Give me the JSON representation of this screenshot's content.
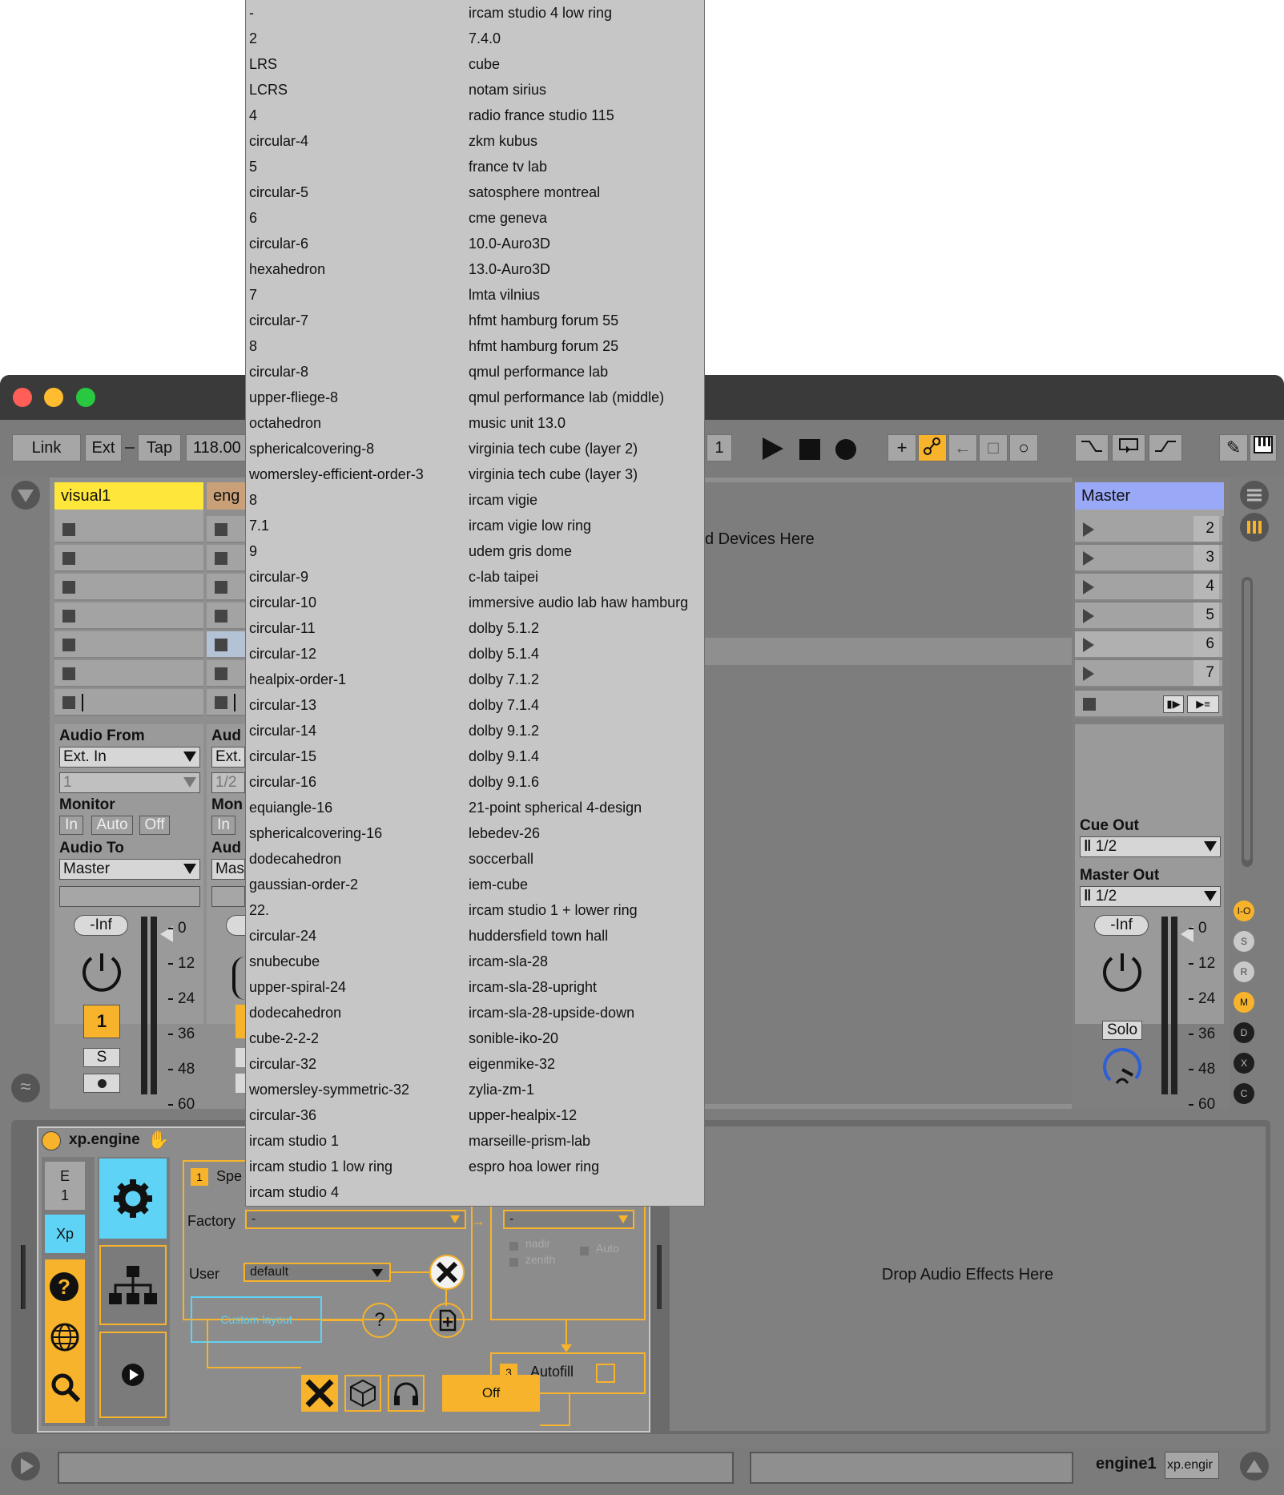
{
  "window": {
    "title_controls": [
      "close",
      "minimize",
      "zoom"
    ]
  },
  "transport": {
    "link": "Link",
    "ext": "Ext",
    "tap": "Tap",
    "tempo": "118.00",
    "bar": "1"
  },
  "tracks": {
    "visual1": {
      "name": "visual1",
      "audio_from_label": "Audio From",
      "audio_from_value": "Ext. In",
      "channel_value": "1",
      "monitor_label": "Monitor",
      "monitor_options": [
        "In",
        "Auto",
        "Off"
      ],
      "audio_to_label": "Audio To",
      "audio_to_value": "Master",
      "volume": "-Inf",
      "track_number": "1",
      "solo": "S"
    },
    "engine1_partial": {
      "name": "eng",
      "audio_from_label": "Aud",
      "audio_from_value": "Ext.",
      "channel_value": "1/2",
      "monitor_label": "Mon",
      "monitor_in": "In",
      "audio_to_label": "Aud",
      "audio_to_value": "Mas"
    },
    "master": {
      "name": "Master",
      "scenes": [
        "2",
        "3",
        "4",
        "5",
        "6",
        "7"
      ],
      "cue_out_label": "Cue Out",
      "cue_out_value": "1/2",
      "master_out_label": "Master Out",
      "master_out_value": "1/2",
      "volume": "-Inf",
      "solo": "Solo"
    }
  },
  "meter_ticks": [
    "0",
    "12",
    "24",
    "36",
    "48",
    "60"
  ],
  "drop_devices_text": "d Devices Here",
  "device": {
    "name": "xp.engine",
    "tab_e": "E",
    "tab_e_num": "1",
    "tab_xp": "Xp",
    "section1_num": "1",
    "section1_label": "Spe",
    "factory_label": "Factory",
    "factory_value": "-",
    "second_value": "-",
    "user_label": "User",
    "user_value": "default",
    "nadir": "nadir",
    "zenith": "zenith",
    "auto": "Auto",
    "custom_layout": "Custom layout",
    "help_q": "?",
    "autofill_num": "3",
    "autofill_label": "Autofill",
    "off_button": "Off",
    "drop_effects": "Drop Audio Effects Here"
  },
  "status": {
    "track_name": "engine1",
    "device_name": "xp.engir"
  },
  "side_letters": [
    "I-O",
    "S",
    "R",
    "M",
    "D",
    "X",
    "C"
  ],
  "menu": {
    "col1": [
      "-",
      "2",
      "LRS",
      "LCRS",
      "4",
      "circular-4",
      "5",
      "circular-5",
      "6",
      "circular-6",
      "hexahedron",
      "7",
      "circular-7",
      "8",
      "circular-8",
      "upper-fliege-8",
      "octahedron",
      "sphericalcovering-8",
      "womersley-efficient-order-3",
      "8",
      "7.1",
      "9",
      "circular-9",
      "circular-10",
      "circular-11",
      "circular-12",
      "healpix-order-1",
      "circular-13",
      "circular-14",
      "circular-15",
      "circular-16",
      "equiangle-16",
      "sphericalcovering-16",
      "dodecahedron",
      "gaussian-order-2",
      "22.",
      "circular-24",
      "snubecube",
      "upper-spiral-24",
      "dodecahedron",
      "cube-2-2-2",
      "circular-32",
      "womersley-symmetric-32",
      "circular-36",
      "ircam studio 1",
      "ircam studio 1 low ring",
      "ircam studio 4"
    ],
    "col2": [
      "ircam studio 4 low ring",
      "7.4.0",
      "cube",
      "notam sirius",
      "radio france studio 115",
      "zkm kubus",
      "france tv lab",
      "satosphere montreal",
      "cme geneva",
      "10.0-Auro3D",
      "13.0-Auro3D",
      "lmta vilnius",
      "hfmt hamburg forum 55",
      "hfmt hamburg forum 25",
      "qmul performance lab",
      "qmul performance lab (middle)",
      "music unit 13.0",
      "virginia tech cube (layer 2)",
      "virginia tech cube (layer 3)",
      "ircam vigie",
      "ircam vigie low ring",
      "udem gris dome",
      "c-lab taipei",
      "immersive audio lab haw hamburg",
      "dolby 5.1.2",
      "dolby 5.1.4",
      "dolby 7.1.2",
      "dolby 7.1.4",
      "dolby 9.1.2",
      "dolby 9.1.4",
      "dolby 9.1.6",
      "21-point spherical 4-design",
      "lebedev-26",
      "soccerball",
      "iem-cube",
      "ircam studio 1 + lower ring",
      "huddersfield town hall",
      "ircam-sla-28",
      "ircam-sla-28-upright",
      "ircam-sla-28-upside-down",
      "sonible-iko-20",
      "eigenmike-32",
      "zylia-zm-1",
      "upper-healpix-12",
      "marseille-prism-lab",
      "espro hoa lower ring"
    ]
  },
  "colors": {
    "accent_orange": "#f7b32b",
    "track_yellow": "#ffe63a",
    "master_blue": "#9aa8f8",
    "device_cyan": "#5fd3f5"
  }
}
